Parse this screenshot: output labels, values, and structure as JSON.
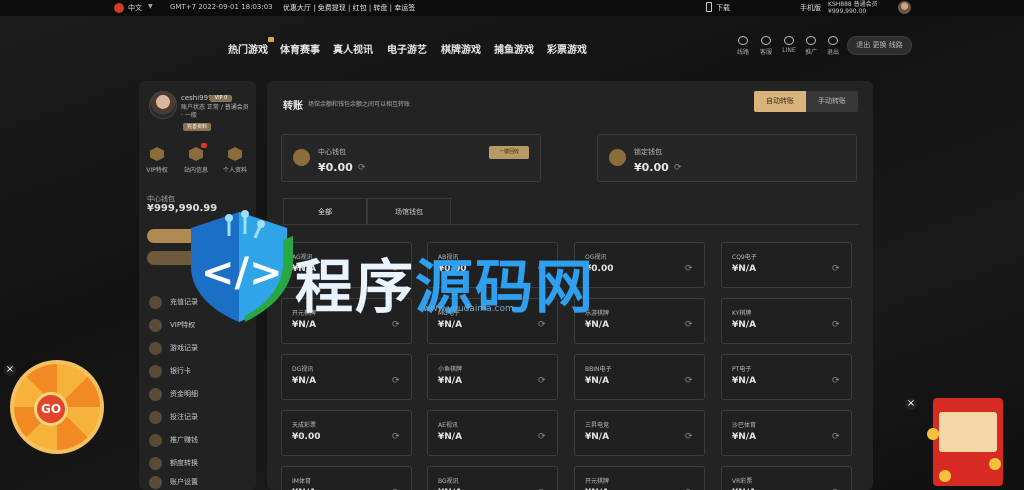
{
  "topbar": {
    "language": "中文",
    "time": "GMT+7 2022-09-01 18:03:03",
    "links": "优惠大厅 | 免费提现 | 红包 | 转盘 | 幸运签",
    "download": "下载",
    "mobile": "手机版",
    "user_line1": "KSH888 普通会员",
    "user_line2": "¥999,990.00"
  },
  "nav": {
    "items": [
      "热门游戏",
      "体育赛事",
      "真人视讯",
      "电子游艺",
      "棋牌游戏",
      "捕鱼游戏",
      "彩票游戏"
    ],
    "icons": [
      {
        "icon": "globe-icon",
        "label": "线路"
      },
      {
        "icon": "headset-icon",
        "label": "客服"
      },
      {
        "icon": "chat-icon",
        "label": "LINE"
      },
      {
        "icon": "group-icon",
        "label": "推广"
      },
      {
        "icon": "lock-icon",
        "label": "退出"
      }
    ],
    "button": "退出 更换 线路"
  },
  "sidebar": {
    "name": "ceshi999",
    "vip": "VIP 0",
    "sub": "账户状态 正常 / 普通会员 · 一般",
    "badge": "完善资料",
    "quick": [
      {
        "icon": "vip-icon",
        "label": "VIP特权"
      },
      {
        "icon": "message-icon",
        "label": "站内信息"
      },
      {
        "icon": "user-icon",
        "label": "个人资料"
      }
    ],
    "balance_label": "中心钱包",
    "balance": "¥999,990.99",
    "menu": [
      "充值记录",
      "VIP特权",
      "游戏记录",
      "银行卡",
      "资金明细",
      "投注记录",
      "推广赚钱",
      "额度转换",
      "账户设置"
    ]
  },
  "main": {
    "title": "转账",
    "desc": "场馆余额和钱包余额之间可以相互转账",
    "toggle_on": "自动转账",
    "toggle_off": "手动转账",
    "wallet_center": {
      "label": "中心钱包",
      "amount": "¥0.00",
      "button": "一键回收"
    },
    "wallet_locked": {
      "label": "锁定钱包",
      "amount": "¥0.00"
    },
    "tabs": [
      "全部",
      "场馆钱包"
    ],
    "cards": [
      {
        "name": "AG视讯",
        "amount": "¥N/A"
      },
      {
        "name": "AB视讯",
        "amount": "¥0.00"
      },
      {
        "name": "OG视讯",
        "amount": "¥0.00"
      },
      {
        "name": "CQ9电子",
        "amount": "¥N/A"
      },
      {
        "name": "开元棋牌",
        "amount": "¥N/A"
      },
      {
        "name": "MG电子",
        "amount": "¥N/A"
      },
      {
        "name": "乐游棋牌",
        "amount": "¥N/A"
      },
      {
        "name": "KY棋牌",
        "amount": "¥N/A"
      },
      {
        "name": "DG视讯",
        "amount": "¥N/A"
      },
      {
        "name": "小鱼棋牌",
        "amount": "¥N/A"
      },
      {
        "name": "BBIN电子",
        "amount": "¥N/A"
      },
      {
        "name": "PT电子",
        "amount": "¥N/A"
      },
      {
        "name": "天成彩票",
        "amount": "¥0.00"
      },
      {
        "name": "AE视讯",
        "amount": "¥N/A"
      },
      {
        "name": "三昇电竞",
        "amount": "¥N/A"
      },
      {
        "name": "沙巴体育",
        "amount": "¥N/A"
      },
      {
        "name": "IM体育",
        "amount": "¥N/A"
      },
      {
        "name": "BG视讯",
        "amount": "¥N/A"
      },
      {
        "name": "开元棋牌",
        "amount": "¥N/A"
      },
      {
        "name": "VR彩票",
        "amount": "¥N/A"
      }
    ]
  },
  "wheel": {
    "label": "GO"
  },
  "watermark": {
    "text_a": "程序",
    "text_b": "源码网",
    "url": "www.youdaima.com"
  },
  "colors": {
    "accent": "#d8b47c",
    "gold": "#8a6d3b",
    "bg": "#121212",
    "panel": "#232323"
  }
}
